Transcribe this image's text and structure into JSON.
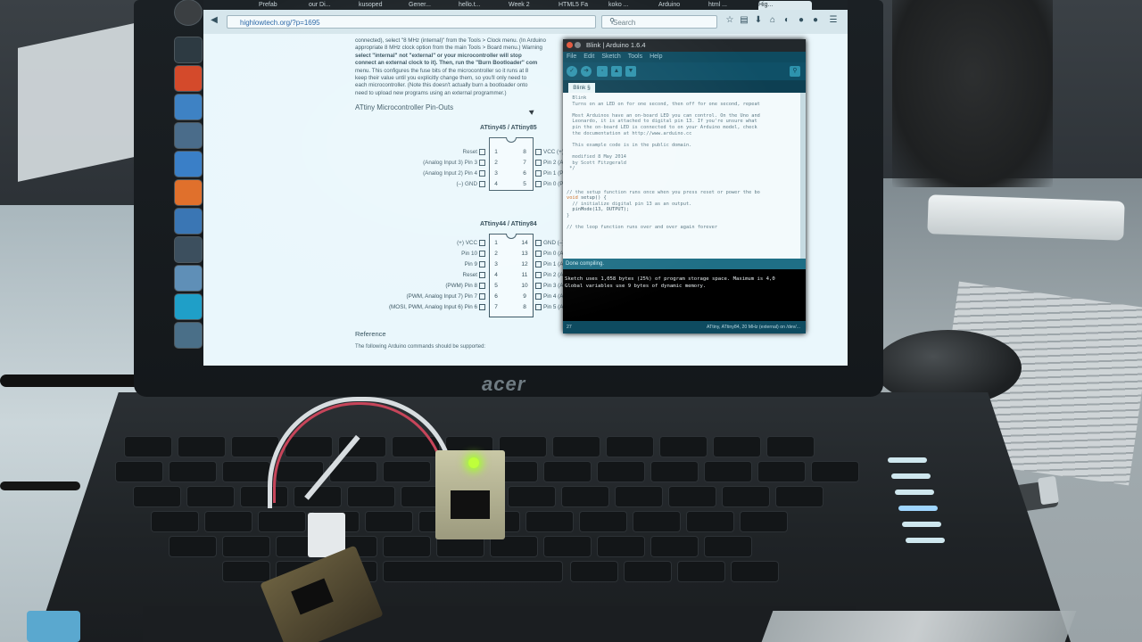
{
  "browser": {
    "tabs": [
      {
        "label": "",
        "active": false
      },
      {
        "label": "Prefab",
        "active": false
      },
      {
        "label": "our Di...",
        "active": false
      },
      {
        "label": "kusoped",
        "active": false
      },
      {
        "label": "Gener...",
        "active": false
      },
      {
        "label": "hello.t...",
        "active": false
      },
      {
        "label": "Week 2",
        "active": false
      },
      {
        "label": "HTML5 Fa",
        "active": false
      },
      {
        "label": "koko ...",
        "active": false
      },
      {
        "label": "Arduino",
        "active": false
      },
      {
        "label": "html ...",
        "active": false
      },
      {
        "label": "Hig...",
        "active": true
      }
    ],
    "url": "highlowtech.org/?p=1695",
    "search_placeholder": "Search",
    "icons": {
      "back": "back-arrow-icon",
      "search": "search-icon",
      "bookmark": "star-icon",
      "menu": "hamburger-icon"
    }
  },
  "launcher": {
    "items": [
      "ubuntu-logo-icon",
      "terminal-icon",
      "software-center-icon",
      "r-icon",
      "files-icon",
      "text-editor-icon",
      "firefox-icon",
      "settings-icon",
      "inkscape-icon",
      "shotwell-icon",
      "arduino-icon",
      "trash-icon"
    ]
  },
  "page": {
    "paragraph_lines": [
      "connected), select \"8 MHz (internal)\" from the Tools > Clock menu. (In Arduino",
      "appropriate 8 MHz clock option from the main Tools > Board menu.) Warning",
      "select \"internal\" not \"external\" or your microcontroller will stop",
      "connect an external clock to it). Then, run the \"Burn Bootloader\" com",
      "menu. This configures the fuse bits of the microcontroller so it runs at 8",
      "keep their value until you explicitly change them, so you'll only need to",
      "each microcontroller. (Note this doesn't actually burn a bootloader onto",
      "need to upload new programs using an external programmer.)"
    ],
    "section_title": "ATtiny Microcontroller Pin-Outs",
    "chip1": {
      "title": "ATtiny45 / ATtiny85",
      "left_pins": [
        "Reset",
        "(Analog Input 3) Pin 3",
        "(Analog Input 2) Pin 4",
        "(–) GND"
      ],
      "right_pins": [
        "VCC (+)",
        "Pin 2 (Analog Input 1, SCK)",
        "Pin 1 (PWM, MISO)",
        "Pin 0 (PWM, AREF, MOSI)"
      ],
      "left_numbers": [
        "1",
        "2",
        "3",
        "4"
      ],
      "right_numbers": [
        "8",
        "7",
        "6",
        "5"
      ]
    },
    "chip2": {
      "title": "ATtiny44 / ATtiny84",
      "left_pins": [
        "(+) VCC",
        "Pin 10",
        "Pin 9",
        "Reset",
        "(PWM) Pin 8",
        "(PWM, Analog Input 7) Pin 7",
        "(MOSI, PWM, Analog Input 6) Pin 6"
      ],
      "right_pins": [
        "GND (–)",
        "Pin 0 (Analog Input 0, AREF)",
        "Pin 1 (Analog Input 1)",
        "Pin 2 (Analog Input 2)",
        "Pin 3 (Analog Input 3)",
        "Pin 4 (Analog Input 4, SCK)",
        "Pin 5 (Analog Input 5, PWM, MISO)"
      ],
      "left_numbers": [
        "1",
        "2",
        "3",
        "4",
        "5",
        "6",
        "7"
      ],
      "right_numbers": [
        "14",
        "13",
        "12",
        "11",
        "10",
        "9",
        "8"
      ]
    },
    "reference_title": "Reference",
    "reference_text": "The following Arduino commands should be supported:"
  },
  "arduino": {
    "title": "Blink | Arduino 1.6.4",
    "menu": [
      "File",
      "Edit",
      "Sketch",
      "Tools",
      "Help"
    ],
    "tab": "Blink §",
    "code_lines": [
      "  Blink",
      "  Turns on an LED on for one second, then off for one second, repeat",
      "",
      "  Most Arduinos have an on-board LED you can control. On the Uno and",
      "  Leonardo, it is attached to digital pin 13. If you're unsure what",
      "  pin the on-board LED is connected to on your Arduino model, check",
      "  the documentation at http://www.arduino.cc",
      "",
      "  This example code is in the public domain.",
      "",
      "  modified 8 May 2014",
      "  by Scott Fitzgerald",
      " */",
      "",
      "",
      "",
      "// the setup function runs once when you press reset or power the bo",
      "void setup() {",
      "  // initialize digital pin 13 as an output.",
      "  pinMode(13, OUTPUT);",
      "}",
      "",
      "// the loop function runs over and over again forever"
    ],
    "status": "Done compiling.",
    "console_lines": [
      "Sketch uses 1,058 bytes (25%) of program storage space. Maximum is 4,0",
      "Global variables use 9 bytes of dynamic memory."
    ],
    "footer_line": "27",
    "footer_board": "ATtiny, ATtiny84, 20 MHz (external) on /dev/..."
  },
  "laptop": {
    "brand": "acer"
  },
  "colors": {
    "screen_bg": "#eaf7fc",
    "arduino_teal": "#0d3f52",
    "led_green": "#bfff3b"
  }
}
